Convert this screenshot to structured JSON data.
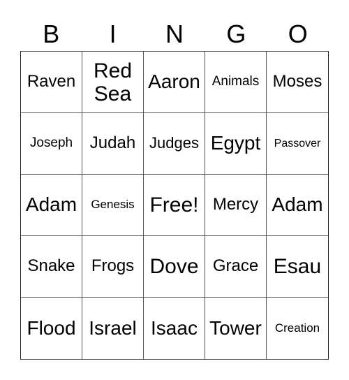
{
  "header": {
    "letters": [
      "B",
      "I",
      "N",
      "G",
      "O"
    ]
  },
  "board": {
    "rows": [
      [
        "Raven",
        "Red Sea",
        "Aaron",
        "Animals",
        "Moses"
      ],
      [
        "Joseph",
        "Judah",
        "Judges",
        "Egypt",
        "Passover"
      ],
      [
        "Adam",
        "Genesis",
        "Free!",
        "Mercy",
        "Adam"
      ],
      [
        "Snake",
        "Frogs",
        "Dove",
        "Grace",
        "Esau"
      ],
      [
        "Flood",
        "Israel",
        "Isaac",
        "Tower",
        "Creation"
      ]
    ],
    "free_space": "Free!"
  }
}
